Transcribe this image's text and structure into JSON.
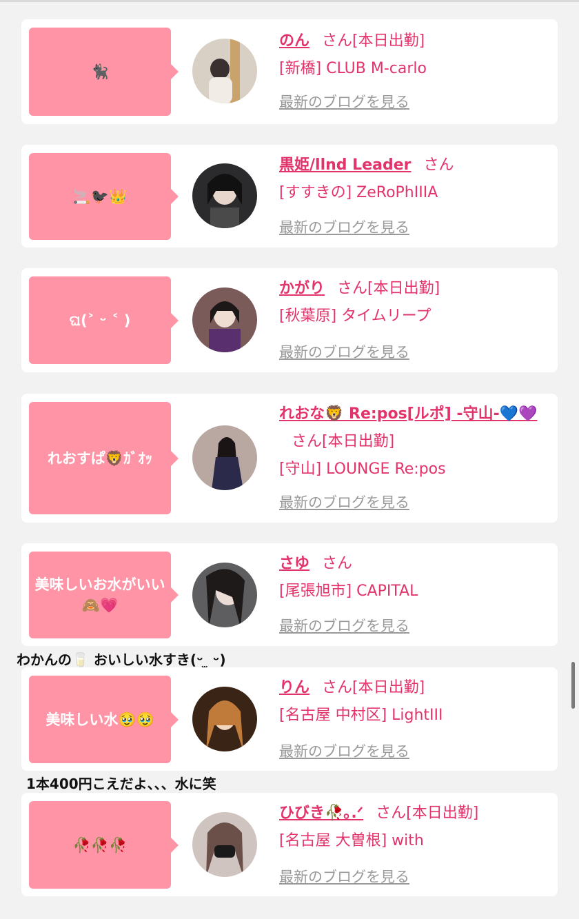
{
  "cards": [
    {
      "bubble": "🐈‍⬛",
      "name": "のん",
      "suffix": "さん[本日出勤]",
      "shop": "[新橋] CLUB M-carlo",
      "blog": "最新のブログを見る"
    },
    {
      "bubble": "🚬🐦‍⬛👑",
      "name": "黒姫/llnd Leader",
      "suffix": "さん",
      "shop": "[すすきの] ZeRoPhIIIA",
      "blog": "最新のブログを見る"
    },
    {
      "bubble": "ଘ(˃ ᵕ ˂ )",
      "name": "かがり",
      "suffix": "さん[本日出勤]",
      "shop": "[秋葉原] タイムリープ",
      "blog": "最新のブログを見る"
    },
    {
      "bubble": "れおすぱ🦁ｶﾞｵｯ",
      "name": "れおな🦁 Re:pos[ルポ] -守山-💙💜",
      "suffix": "さん[本日出勤]",
      "shop": "[守山] LOUNGE Re:pos",
      "blog": "最新のブログを見る"
    },
    {
      "bubble": "美味しいお水がいい🙈💗",
      "name": "さゆ",
      "suffix": "さん",
      "shop": "[尾張旭市] CAPITAL",
      "blog": "最新のブログを見る"
    },
    {
      "bubble": "美味しい水🥹🥹",
      "name": "りん",
      "suffix": "さん[本日出勤]",
      "shop": "[名古屋 中村区] LightIII",
      "blog": "最新のブログを見る"
    },
    {
      "bubble": "🥀🥀🥀",
      "name": "ひびき🥀｡.ᐟ",
      "suffix": "さん[本日出勤]",
      "shop": "[名古屋 大曽根] with",
      "blog": "最新のブログを見る"
    }
  ],
  "comments": {
    "c1": "わかんの🥛 おいしい水すき(ᵕ ̫ ᵕ)",
    "c2": "1本400円こえだよ、、、水に笑"
  },
  "colors": {
    "accent": "#e2336b",
    "bubble": "#ff94a6",
    "link_gray": "#999999",
    "background": "#f2f2f2"
  }
}
